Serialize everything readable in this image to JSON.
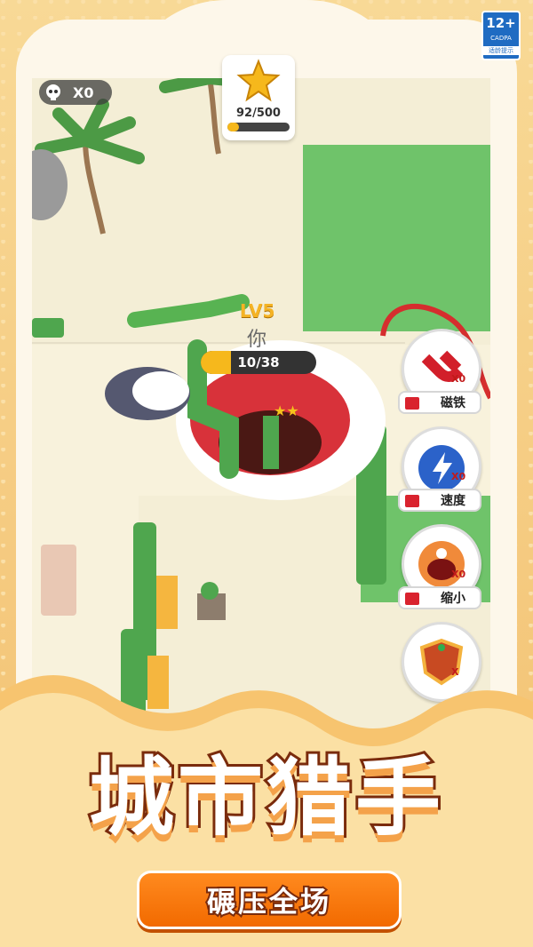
{
  "rating": {
    "number": "12+",
    "org": "CADPA",
    "tip": "适龄提示"
  },
  "hud": {
    "kills": "X0",
    "stars": {
      "label": "92/500",
      "progress": 0.184
    }
  },
  "player": {
    "level": "LV5",
    "name": "你",
    "progress_label": "10/38",
    "progress": 0.263
  },
  "powerups": [
    {
      "name": "磁铁",
      "count": "X0",
      "icon": "magnet-icon"
    },
    {
      "name": "速度",
      "count": "X0",
      "icon": "lightning-icon"
    },
    {
      "name": "缩小",
      "count": "X0",
      "icon": "monster-icon"
    },
    {
      "name": "",
      "count": "X",
      "icon": "shield-icon"
    }
  ],
  "banner": {
    "title": "城市猎手",
    "subtitle": "碾压全场"
  },
  "colors": {
    "accent": "#f6b81c",
    "orange": "#f26a00",
    "grass": "#6fc36a"
  }
}
